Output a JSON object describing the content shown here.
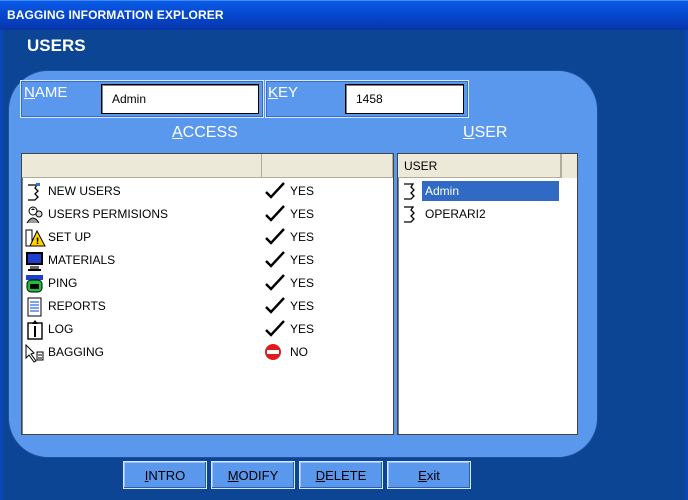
{
  "window": {
    "title": "BAGGING INFORMATION EXPLORER"
  },
  "page": {
    "heading": "USERS"
  },
  "form": {
    "name_label_u": "N",
    "name_label_rest": "AME",
    "name_value": "Admin",
    "key_label_u": "K",
    "key_label_rest": "EY",
    "key_value": "1458"
  },
  "access": {
    "title_u": "A",
    "title_rest": "CCESS",
    "rows": [
      {
        "label": "NEW USERS",
        "value": "YES",
        "icon": "new-user-icon",
        "status": "check"
      },
      {
        "label": "USERS PERMISIONS",
        "value": "YES",
        "icon": "users-permissions-icon",
        "status": "check"
      },
      {
        "label": "SET UP",
        "value": "YES",
        "icon": "setup-icon",
        "status": "check"
      },
      {
        "label": "MATERIALS",
        "value": "YES",
        "icon": "materials-icon",
        "status": "check"
      },
      {
        "label": "PING",
        "value": "YES",
        "icon": "ping-icon",
        "status": "check"
      },
      {
        "label": "REPORTS",
        "value": "YES",
        "icon": "reports-icon",
        "status": "check"
      },
      {
        "label": "LOG",
        "value": "YES",
        "icon": "log-icon",
        "status": "check"
      },
      {
        "label": "BAGGING",
        "value": "NO",
        "icon": "bagging-icon",
        "status": "deny"
      }
    ]
  },
  "user_list": {
    "title_u": "U",
    "title_rest": "SER",
    "column_header": "USER",
    "items": [
      {
        "label": "Admin",
        "selected": true
      },
      {
        "label": "OPERARI2",
        "selected": false
      }
    ]
  },
  "buttons": [
    {
      "u": "I",
      "rest": "NTRO"
    },
    {
      "u": "M",
      "rest": "ODIFY"
    },
    {
      "u": "D",
      "rest": "ELETE"
    },
    {
      "u": "E",
      "rest": "xit"
    }
  ],
  "colors": {
    "accent": "#316ac5",
    "panel": "#5a98ee",
    "background": "#0b4593",
    "deny": "#e01a1a"
  }
}
